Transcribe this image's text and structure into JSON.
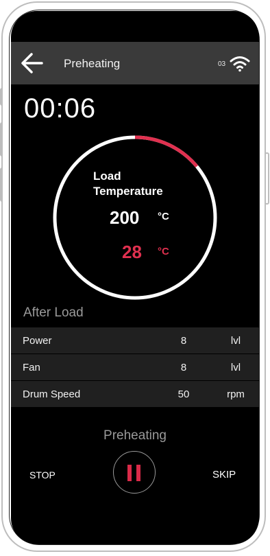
{
  "header": {
    "title": "Preheating",
    "signal_count": "03",
    "icons": [
      "back-arrow-icon",
      "wifi-icon"
    ]
  },
  "timer": "00:06",
  "gauge": {
    "title": "Load Temperature",
    "target_value": "200",
    "target_unit": "°C",
    "current_value": "28",
    "current_unit": "°C",
    "progress_fraction": 0.14,
    "accent_color": "#e0304f"
  },
  "after_load": {
    "title": "After Load",
    "rows": [
      {
        "label": "Power",
        "value": "8",
        "unit": "lvl"
      },
      {
        "label": "Fan",
        "value": "8",
        "unit": "lvl"
      },
      {
        "label": "Drum Speed",
        "value": "50",
        "unit": "rpm"
      }
    ]
  },
  "controls": {
    "status": "Preheating",
    "stop_label": "STOP",
    "skip_label": "SKIP",
    "pause_icon": "pause-icon",
    "pause_color": "#d92a48"
  }
}
